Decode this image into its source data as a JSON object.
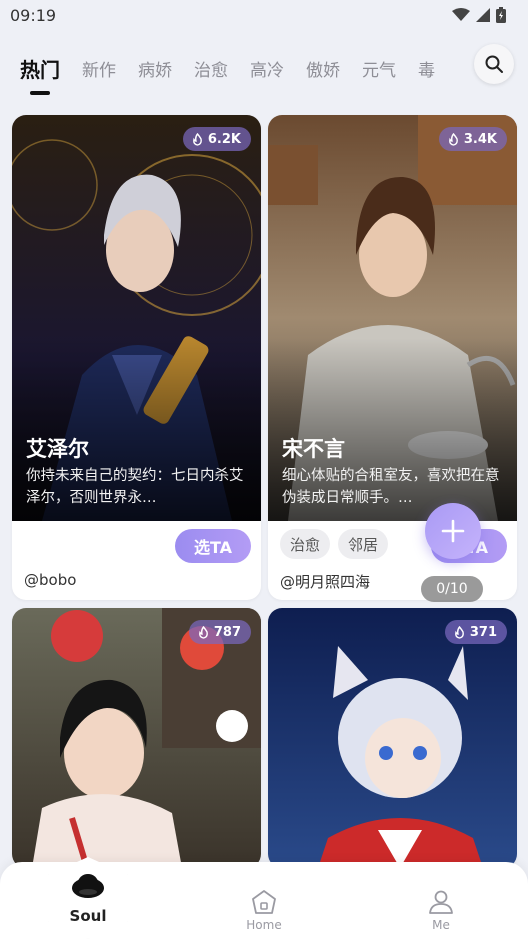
{
  "status": {
    "time": "09:19"
  },
  "tabs": [
    {
      "label": "热门",
      "active": true
    },
    {
      "label": "新作"
    },
    {
      "label": "病娇"
    },
    {
      "label": "治愈"
    },
    {
      "label": "高冷"
    },
    {
      "label": "傲娇"
    },
    {
      "label": "元气"
    },
    {
      "label": "毒"
    }
  ],
  "cards": [
    {
      "badge": "6.2K",
      "name": "艾泽尔",
      "desc": "你持未来自己的契约：七日内杀艾泽尔，否则世界永…",
      "button": "选TA",
      "author": "@bobo"
    },
    {
      "badge": "3.4K",
      "name": "宋不言",
      "desc": "细心体贴的合租室友，喜欢把在意伪装成日常顺手。…",
      "button": "选TA",
      "tags": [
        "治愈",
        "邻居"
      ],
      "author": "@明月照四海"
    },
    {
      "badge": "787"
    },
    {
      "badge": "371"
    }
  ],
  "page_counter": "0/10",
  "bottom_nav": {
    "soul": "Soul",
    "home": "Home",
    "me": "Me"
  },
  "colors": {
    "accent": "#a393f3",
    "badge_bg": "#7a68be"
  }
}
